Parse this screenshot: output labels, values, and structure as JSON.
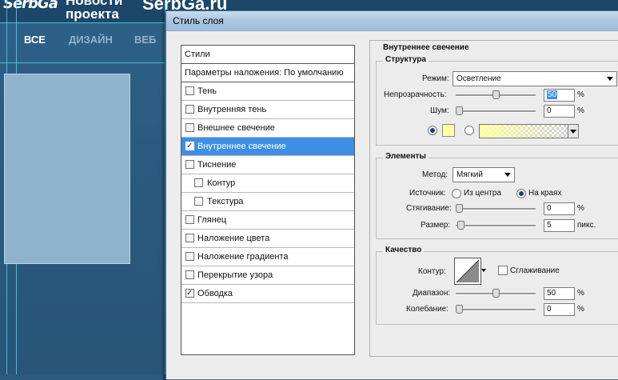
{
  "background": {
    "logo_left": "SerbGa",
    "logo_mid_line1": "Новости",
    "logo_mid_line2": "проекта",
    "logo_right": "SerbGa.ru",
    "nav": [
      "ВСЕ",
      "ДИЗАЙН",
      "ВЕБ"
    ]
  },
  "dialog": {
    "title": "Стиль слоя",
    "styles_header": "Стили",
    "blend_defaults": "Параметры наложения: По умолчанию",
    "items": [
      {
        "label": "Тень",
        "checked": false,
        "sub": false,
        "selected": false
      },
      {
        "label": "Внутренняя тень",
        "checked": false,
        "sub": false,
        "selected": false
      },
      {
        "label": "Внешнее свечение",
        "checked": false,
        "sub": false,
        "selected": false
      },
      {
        "label": "Внутреннее свечение",
        "checked": true,
        "sub": false,
        "selected": true
      },
      {
        "label": "Тиснение",
        "checked": false,
        "sub": false,
        "selected": false
      },
      {
        "label": "Контур",
        "checked": false,
        "sub": true,
        "selected": false
      },
      {
        "label": "Текстура",
        "checked": false,
        "sub": true,
        "selected": false
      },
      {
        "label": "Глянец",
        "checked": false,
        "sub": false,
        "selected": false
      },
      {
        "label": "Наложение цвета",
        "checked": false,
        "sub": false,
        "selected": false
      },
      {
        "label": "Наложение градиента",
        "checked": false,
        "sub": false,
        "selected": false
      },
      {
        "label": "Перекрытие узора",
        "checked": false,
        "sub": false,
        "selected": false
      },
      {
        "label": "Обводка",
        "checked": true,
        "sub": false,
        "selected": false
      }
    ],
    "panel_title": "Внутреннее свечение",
    "structure": {
      "title": "Структура",
      "mode_label": "Режим:",
      "mode_value": "Осветление",
      "opacity_label": "Непрозрачность:",
      "opacity_value": "50",
      "opacity_unit": "%",
      "opacity_level": 50,
      "noise_label": "Шум:",
      "noise_value": "0",
      "noise_unit": "%",
      "noise_level": 0,
      "swatch_color": "#ffffa8"
    },
    "elements": {
      "title": "Элементы",
      "method_label": "Метод:",
      "method_value": "Мягкий",
      "source_label": "Источник:",
      "source_center": "Из центра",
      "source_edge": "На краях",
      "choke_label": "Стягивание:",
      "choke_value": "0",
      "choke_unit": "%",
      "choke_level": 0,
      "size_label": "Размер:",
      "size_value": "5",
      "size_unit": "пикс.",
      "size_level": 2
    },
    "quality": {
      "title": "Качество",
      "contour_label": "Контур:",
      "antialias_label": "Сглаживание",
      "range_label": "Диапазон:",
      "range_value": "50",
      "range_unit": "%",
      "range_level": 50,
      "jitter_label": "Колебание:",
      "jitter_value": "0",
      "jitter_unit": "%",
      "jitter_level": 0
    },
    "accent_color": "#3e8fe4"
  }
}
